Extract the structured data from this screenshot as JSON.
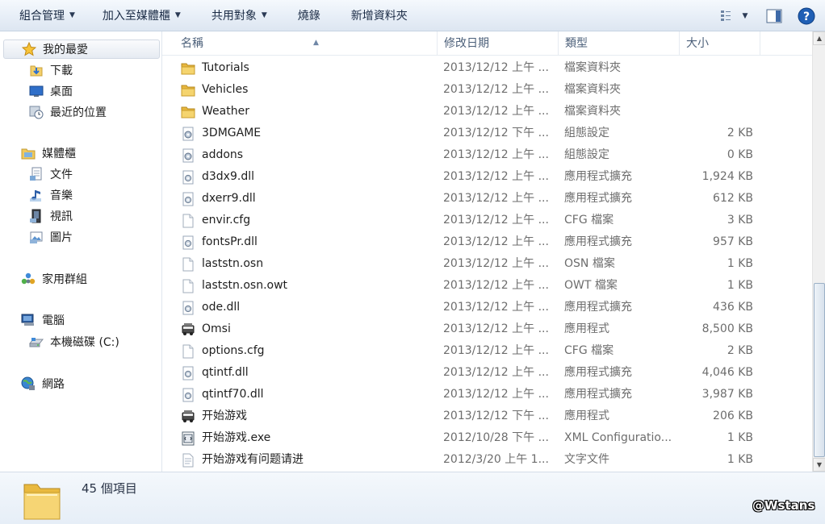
{
  "toolbar": {
    "organize": "組合管理",
    "add_to_library": "加入至媒體櫃",
    "share_with": "共用對象",
    "burn": "燒錄",
    "new_folder": "新增資料夾"
  },
  "nav": {
    "favorites": "我的最愛",
    "downloads": "下載",
    "desktop": "桌面",
    "recent": "最近的位置",
    "libraries": "媒體櫃",
    "documents": "文件",
    "music": "音樂",
    "videos": "視訊",
    "pictures": "圖片",
    "homegroup": "家用群組",
    "computer": "電腦",
    "local_disk": "本機磁碟 (C:)",
    "network": "網路"
  },
  "columns": {
    "name": "名稱",
    "date": "修改日期",
    "type": "類型",
    "size": "大小"
  },
  "files": [
    {
      "name": "Tutorials",
      "date": "2013/12/12 上午 ...",
      "type": "檔案資料夾",
      "size": "",
      "icon": "folder-icon"
    },
    {
      "name": "Vehicles",
      "date": "2013/12/12 上午 ...",
      "type": "檔案資料夾",
      "size": "",
      "icon": "folder-icon"
    },
    {
      "name": "Weather",
      "date": "2013/12/12 上午 ...",
      "type": "檔案資料夾",
      "size": "",
      "icon": "folder-icon"
    },
    {
      "name": "3DMGAME",
      "date": "2013/12/12 下午 ...",
      "type": "組態設定",
      "size": "2 KB",
      "icon": "settings-file-icon"
    },
    {
      "name": "addons",
      "date": "2013/12/12 上午 ...",
      "type": "組態設定",
      "size": "0 KB",
      "icon": "settings-file-icon"
    },
    {
      "name": "d3dx9.dll",
      "date": "2013/12/12 上午 ...",
      "type": "應用程式擴充",
      "size": "1,924 KB",
      "icon": "dll-file-icon"
    },
    {
      "name": "dxerr9.dll",
      "date": "2013/12/12 上午 ...",
      "type": "應用程式擴充",
      "size": "612 KB",
      "icon": "dll-file-icon"
    },
    {
      "name": "envir.cfg",
      "date": "2013/12/12 上午 ...",
      "type": "CFG 檔案",
      "size": "3 KB",
      "icon": "blank-file-icon"
    },
    {
      "name": "fontsPr.dll",
      "date": "2013/12/12 上午 ...",
      "type": "應用程式擴充",
      "size": "957 KB",
      "icon": "dll-file-icon"
    },
    {
      "name": "laststn.osn",
      "date": "2013/12/12 上午 ...",
      "type": "OSN 檔案",
      "size": "1 KB",
      "icon": "blank-file-icon"
    },
    {
      "name": "laststn.osn.owt",
      "date": "2013/12/12 上午 ...",
      "type": "OWT 檔案",
      "size": "1 KB",
      "icon": "blank-file-icon"
    },
    {
      "name": "ode.dll",
      "date": "2013/12/12 上午 ...",
      "type": "應用程式擴充",
      "size": "436 KB",
      "icon": "dll-file-icon"
    },
    {
      "name": "Omsi",
      "date": "2013/12/12 上午 ...",
      "type": "應用程式",
      "size": "8,500 KB",
      "icon": "app-exe-icon"
    },
    {
      "name": "options.cfg",
      "date": "2013/12/12 上午 ...",
      "type": "CFG 檔案",
      "size": "2 KB",
      "icon": "blank-file-icon"
    },
    {
      "name": "qtintf.dll",
      "date": "2013/12/12 上午 ...",
      "type": "應用程式擴充",
      "size": "4,046 KB",
      "icon": "dll-file-icon"
    },
    {
      "name": "qtintf70.dll",
      "date": "2013/12/12 上午 ...",
      "type": "應用程式擴充",
      "size": "3,987 KB",
      "icon": "dll-file-icon"
    },
    {
      "name": "开始游戏",
      "date": "2013/12/12 下午 ...",
      "type": "應用程式",
      "size": "206 KB",
      "icon": "app-exe-icon"
    },
    {
      "name": "开始游戏.exe",
      "date": "2012/10/28 下午 ...",
      "type": "XML Configuratio...",
      "size": "1 KB",
      "icon": "xml-file-icon"
    },
    {
      "name": "开始游戏有问题请进",
      "date": "2012/3/20 上午 1...",
      "type": "文字文件",
      "size": "1 KB",
      "icon": "text-file-icon"
    }
  ],
  "status": {
    "item_count": "45 個項目"
  },
  "watermark": "@Wstans"
}
